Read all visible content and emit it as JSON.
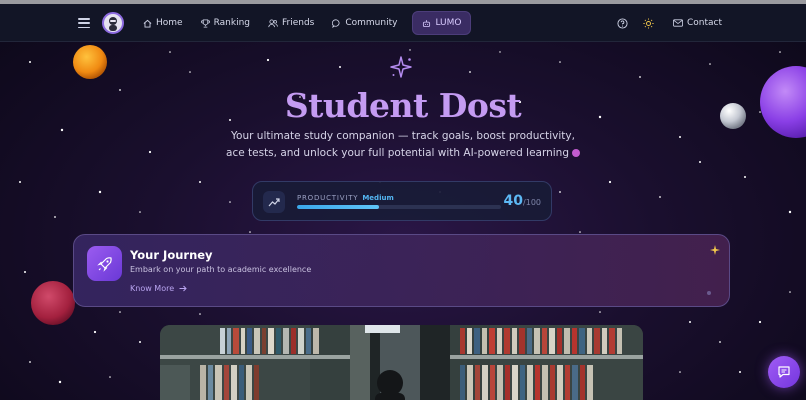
{
  "nav": {
    "items": [
      {
        "label": "Home",
        "icon": "home-icon"
      },
      {
        "label": "Ranking",
        "icon": "trophy-icon"
      },
      {
        "label": "Friends",
        "icon": "users-icon"
      },
      {
        "label": "Community",
        "icon": "chat-bubble-icon"
      }
    ],
    "active_label": "LUMO",
    "contact_label": "Contact"
  },
  "hero": {
    "title": "Student Dost",
    "subtitle_line1": "Your ultimate study companion — track goals, boost productivity,",
    "subtitle_line2": "ace tests, and unlock your full potential with AI-powered learning"
  },
  "productivity": {
    "label": "PRODUCTIVITY",
    "level": "Medium",
    "score": "40",
    "max": "/100",
    "fraction": 0.4
  },
  "journey": {
    "title": "Your Journey",
    "subtitle": "Embark on your path to academic excellence",
    "link_label": "Know More"
  },
  "colors": {
    "accent": "#c49bf2",
    "progress": "#5db8f4",
    "nav_bg": "#121526"
  }
}
